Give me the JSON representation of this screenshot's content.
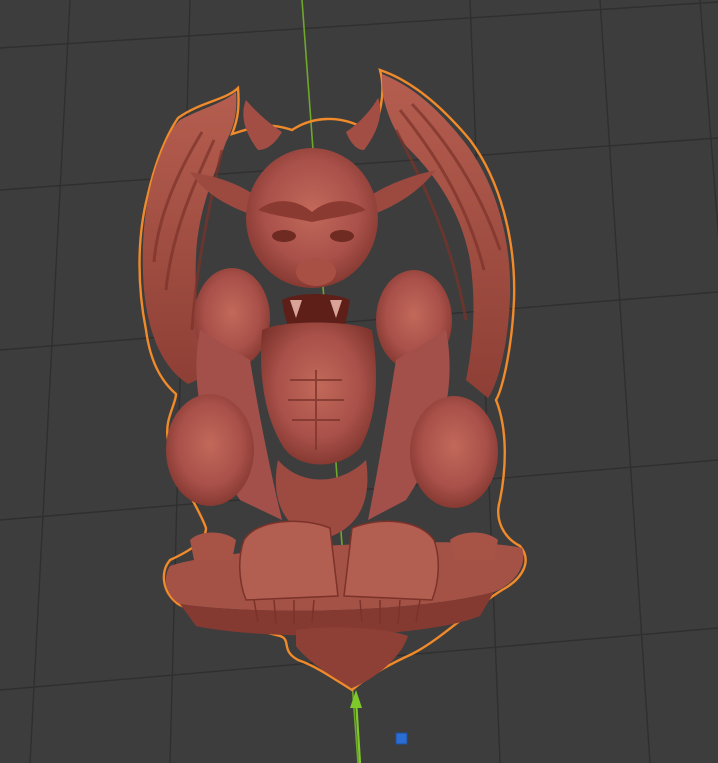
{
  "viewport": {
    "background_color": "#3d3d3d",
    "grid_color": "#2e2e2e",
    "y_axis_color": "#7fbf2a"
  },
  "object": {
    "name": "gargoyle-sculpt",
    "material_color": "#b0574a",
    "shadow_color": "#7a3028",
    "highlight_color": "#d07a6a",
    "selection_outline_color": "#f08a2a",
    "selected": true
  },
  "gizmo": {
    "arrow_color": "#7fc82a",
    "origin_marker_color": "#2a6ed4",
    "origin_marker_icon": "blue-square-icon"
  }
}
